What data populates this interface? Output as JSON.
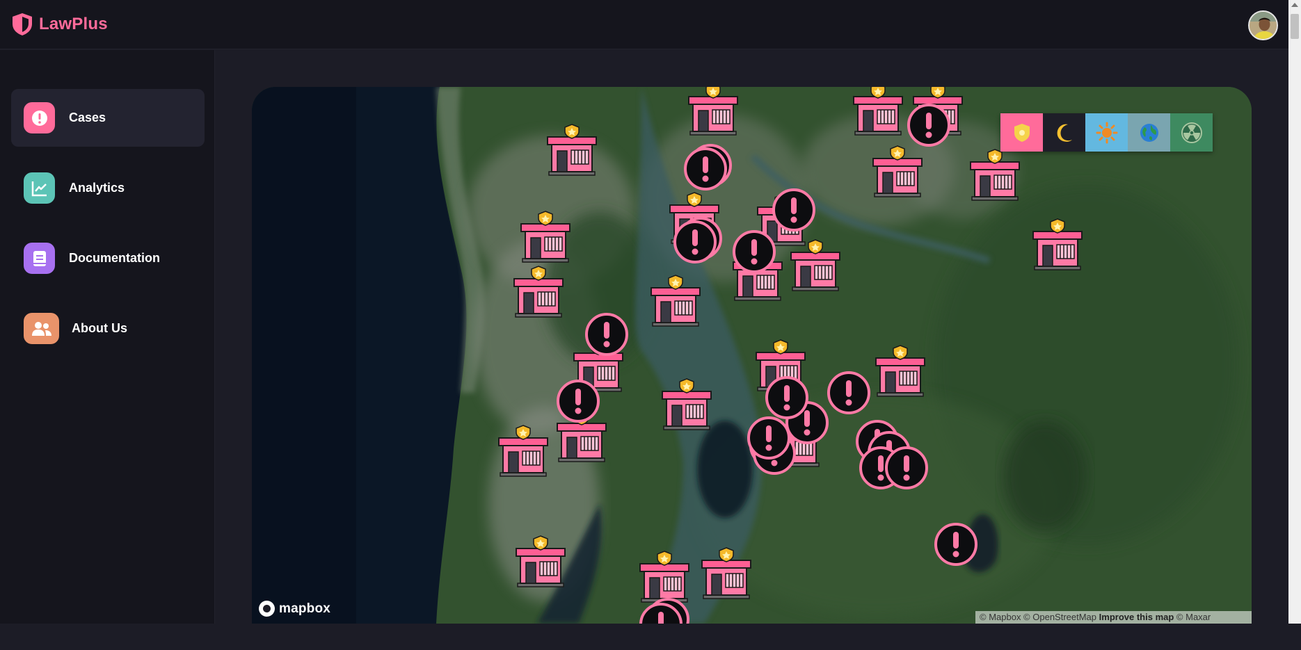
{
  "app": {
    "brand": "LawPlus",
    "brand_color": "#ff6b9a",
    "brand_icon": "shield-icon",
    "avatar_icon": "user-avatar"
  },
  "sidebar": {
    "items": [
      {
        "label": "Cases",
        "icon": "alert-circle-icon",
        "color": "#ff6b9a",
        "active": true
      },
      {
        "label": "Analytics",
        "icon": "chart-line-icon",
        "color": "#5cc4b6",
        "active": false
      },
      {
        "label": "Documentation",
        "icon": "document-icon",
        "color": "#a770f0",
        "active": false
      },
      {
        "label": "About Us",
        "icon": "users-icon",
        "color": "#e9936a",
        "active": false
      }
    ]
  },
  "map": {
    "logo_text": "mapbox",
    "attribution": {
      "part1": "© Mapbox © OpenStreetMap",
      "link": "Improve this map",
      "part2": "© Maxar"
    },
    "style_buttons": [
      {
        "name": "police-style",
        "icon": "police-badge-icon",
        "color": "#ff6b9a"
      },
      {
        "name": "night-style",
        "icon": "moon-icon",
        "color": "#1e1e28"
      },
      {
        "name": "day-style",
        "icon": "sun-icon",
        "color": "#63b8e0"
      },
      {
        "name": "globe-style",
        "icon": "globe-icon",
        "color": "#7aa5b0"
      },
      {
        "name": "hazard-style",
        "icon": "radiation-icon",
        "color": "#3e8a60"
      }
    ],
    "police_station_count": 28,
    "case_marker_count": 26
  }
}
